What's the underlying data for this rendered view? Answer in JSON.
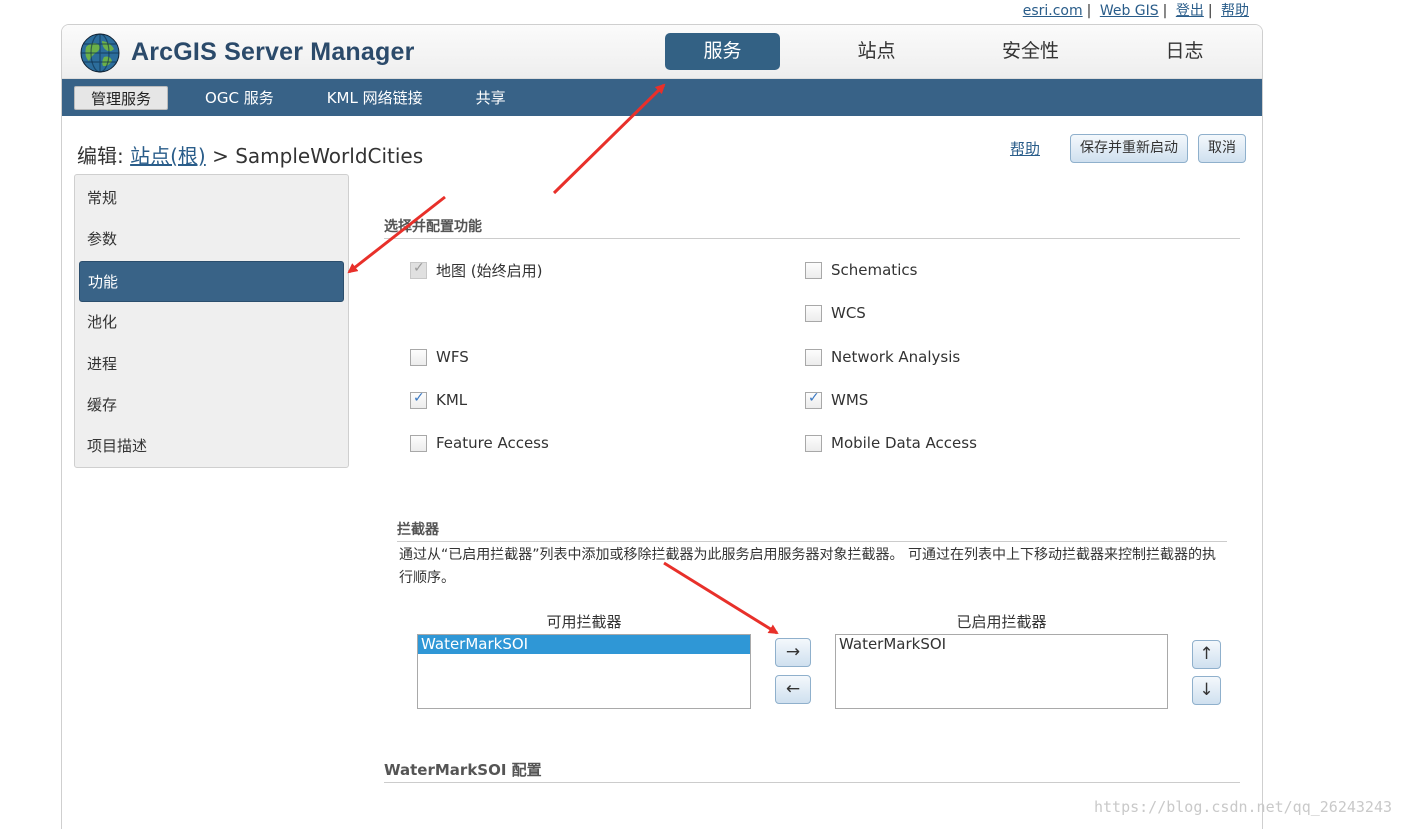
{
  "top_links": [
    "esri.com",
    "Web GIS",
    "登出",
    "帮助"
  ],
  "app": {
    "name": "ArcGIS Server Manager"
  },
  "main_tabs": [
    {
      "label": "服务",
      "active": true
    },
    {
      "label": "站点",
      "active": false
    },
    {
      "label": "安全性",
      "active": false
    },
    {
      "label": "日志",
      "active": false
    }
  ],
  "sub_tabs": [
    {
      "label": "管理服务",
      "active": true
    },
    {
      "label": "OGC 服务",
      "active": false
    },
    {
      "label": "KML 网络链接",
      "active": false
    },
    {
      "label": "共享",
      "active": false
    }
  ],
  "title": {
    "prefix": "编辑:",
    "link": "站点(根)",
    "sep": ">",
    "service": "SampleWorldCities"
  },
  "actions": {
    "help": "帮助",
    "save": "保存并重新启动",
    "cancel": "取消"
  },
  "left_nav": [
    {
      "label": "常规",
      "active": false
    },
    {
      "label": "参数",
      "active": false
    },
    {
      "label": "功能",
      "active": true
    },
    {
      "label": "池化",
      "active": false
    },
    {
      "label": "进程",
      "active": false
    },
    {
      "label": "缓存",
      "active": false
    },
    {
      "label": "项目描述",
      "active": false
    }
  ],
  "capabilities": {
    "section_title": "选择并配置功能",
    "items": [
      {
        "label": "地图 (始终启用)",
        "checked": true,
        "disabled": true
      },
      {
        "label": "Schematics",
        "checked": false,
        "disabled": false
      },
      {
        "label": "WCS",
        "checked": false,
        "disabled": false
      },
      {
        "label": "WFS",
        "checked": false,
        "disabled": false
      },
      {
        "label": "Network Analysis",
        "checked": false,
        "disabled": false
      },
      {
        "label": "KML",
        "checked": true,
        "disabled": false
      },
      {
        "label": "WMS",
        "checked": true,
        "disabled": false
      },
      {
        "label": "Feature Access",
        "checked": false,
        "disabled": false
      },
      {
        "label": "Mobile Data Access",
        "checked": false,
        "disabled": false
      }
    ]
  },
  "interceptors": {
    "section_title": "拦截器",
    "description": "通过从“已启用拦截器”列表中添加或移除拦截器为此服务启用服务器对象拦截器。 可通过在列表中上下移动拦截器来控制拦截器的执行顺序。",
    "available_label": "可用拦截器",
    "available_items": [
      "WaterMarkSOI"
    ],
    "enabled_label": "已启用拦截器",
    "enabled_items": [
      "WaterMarkSOI"
    ],
    "add_glyph": "→",
    "remove_glyph": "←",
    "up_glyph": "↑",
    "down_glyph": "↓"
  },
  "config_section_title": "WaterMarkSOI 配置",
  "watermark": "https://blog.csdn.net/qq_26243243",
  "colors": {
    "nav_blue": "#386287",
    "active_tab": "#336184",
    "annotation_red": "#e8302a",
    "selection": "#2f97d6"
  }
}
